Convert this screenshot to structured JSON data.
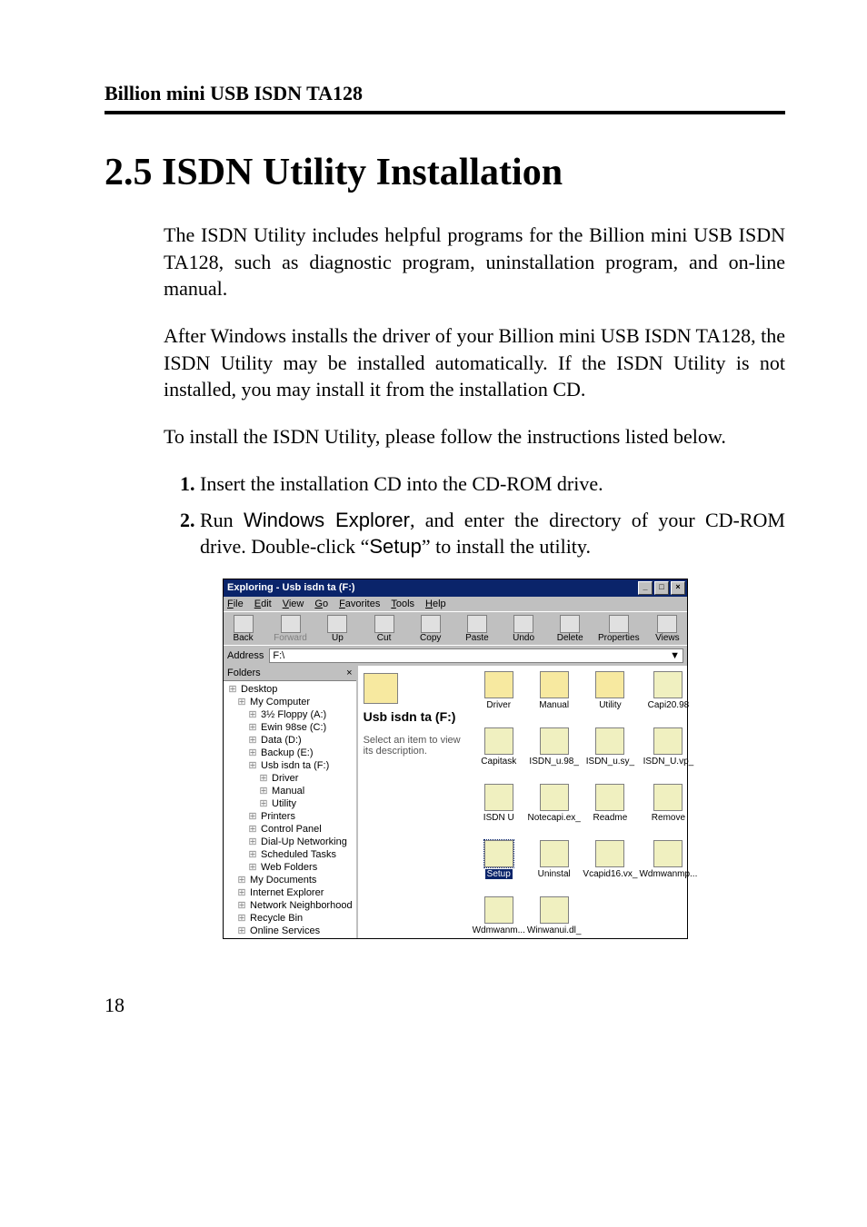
{
  "header": {
    "running_title": "Billion mini USB ISDN TA128"
  },
  "section": {
    "title": "2.5 ISDN Utility Installation"
  },
  "paragraphs": {
    "p1": "The ISDN Utility includes helpful programs for the Billion mini USB ISDN TA128, such as diagnostic program, uninstallation program, and on-line manual.",
    "p2": "After Windows installs the driver of your Billion mini USB ISDN TA128, the ISDN Utility may be installed automatically. If the ISDN Utility is not installed, you may install it from the installation CD.",
    "p3": "To install the ISDN Utility, please follow the instructions listed below."
  },
  "steps": {
    "s1": "Insert the installation CD into the CD-ROM drive.",
    "s2_pre": "Run ",
    "s2_app": "Windows Explorer",
    "s2_mid": ", and enter the directory of your CD-ROM drive. Double-click ",
    "s2_q1": "“",
    "s2_setup": "Setup",
    "s2_q2": "”",
    "s2_post": " to install the utility."
  },
  "screenshot": {
    "title": "Exploring - Usb isdn ta (F:)",
    "menus": [
      "File",
      "Edit",
      "View",
      "Go",
      "Favorites",
      "Tools",
      "Help"
    ],
    "toolbar": [
      {
        "label": "Back",
        "disabled": false
      },
      {
        "label": "Forward",
        "disabled": true
      },
      {
        "label": "Up",
        "disabled": false
      },
      {
        "label": "Cut",
        "disabled": false
      },
      {
        "label": "Copy",
        "disabled": false
      },
      {
        "label": "Paste",
        "disabled": false
      },
      {
        "label": "Undo",
        "disabled": false
      },
      {
        "label": "Delete",
        "disabled": false
      },
      {
        "label": "Properties",
        "disabled": false
      },
      {
        "label": "Views",
        "disabled": false
      }
    ],
    "address_label": "Address",
    "address_value": "F:\\",
    "tree": {
      "header": "Folders",
      "items": [
        {
          "label": "Desktop",
          "indent": 0
        },
        {
          "label": "My Computer",
          "indent": 1
        },
        {
          "label": "3½ Floppy (A:)",
          "indent": 2
        },
        {
          "label": "Ewin 98se (C:)",
          "indent": 2
        },
        {
          "label": "Data (D:)",
          "indent": 2
        },
        {
          "label": "Backup (E:)",
          "indent": 2
        },
        {
          "label": "Usb isdn ta (F:)",
          "indent": 2
        },
        {
          "label": "Driver",
          "indent": 3
        },
        {
          "label": "Manual",
          "indent": 3
        },
        {
          "label": "Utility",
          "indent": 3
        },
        {
          "label": "Printers",
          "indent": 2
        },
        {
          "label": "Control Panel",
          "indent": 2
        },
        {
          "label": "Dial-Up Networking",
          "indent": 2
        },
        {
          "label": "Scheduled Tasks",
          "indent": 2
        },
        {
          "label": "Web Folders",
          "indent": 2
        },
        {
          "label": "My Documents",
          "indent": 1
        },
        {
          "label": "Internet Explorer",
          "indent": 1
        },
        {
          "label": "Network Neighborhood",
          "indent": 1
        },
        {
          "label": "Recycle Bin",
          "indent": 1
        },
        {
          "label": "Online Services",
          "indent": 1
        }
      ]
    },
    "content": {
      "volume": "Usb isdn ta (F:)",
      "hint": "Select an item to view its description.",
      "files": [
        {
          "name": "Driver",
          "type": "folder"
        },
        {
          "name": "Manual",
          "type": "folder"
        },
        {
          "name": "Utility",
          "type": "folder"
        },
        {
          "name": "Capi20.98",
          "type": "file"
        },
        {
          "name": "Capitask",
          "type": "file"
        },
        {
          "name": "ISDN_u.98_",
          "type": "file"
        },
        {
          "name": "ISDN_u.sy_",
          "type": "file"
        },
        {
          "name": "ISDN_U.vp_",
          "type": "file"
        },
        {
          "name": "ISDN U",
          "type": "file"
        },
        {
          "name": "Notecapi.ex_",
          "type": "file"
        },
        {
          "name": "Readme",
          "type": "file"
        },
        {
          "name": "Remove",
          "type": "file"
        },
        {
          "name": "Setup",
          "type": "file",
          "selected": true
        },
        {
          "name": "Uninstal",
          "type": "file"
        },
        {
          "name": "Vcapid16.vx_",
          "type": "file"
        },
        {
          "name": "Wdmwanmp...",
          "type": "file"
        },
        {
          "name": "Wdmwanm...",
          "type": "file"
        },
        {
          "name": "Winwanui.dl_",
          "type": "file"
        }
      ]
    }
  },
  "page_number": "18"
}
